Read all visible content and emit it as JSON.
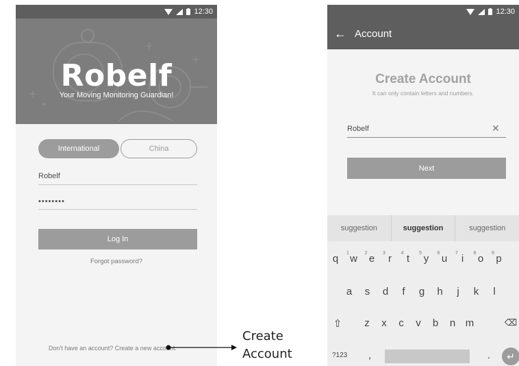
{
  "status_bar": {
    "time": "12:30",
    "icons": [
      "wifi-icon",
      "signal-icon",
      "battery-icon"
    ]
  },
  "login_screen": {
    "logo_text": "Robelf",
    "tagline": "Your Moving Monitoring Guardian!",
    "region_tabs": {
      "international": "International",
      "china": "China",
      "selected": "International"
    },
    "username_value": "Robelf",
    "password_value": "••••••••",
    "login_button": "Log In",
    "forgot_password": "Forgot password?",
    "create_account_link": "Don't have an account? Create a new account."
  },
  "annotation": {
    "line1": "Create",
    "line2": "Account"
  },
  "account_screen": {
    "app_bar_title": "Account",
    "heading": "Create Account",
    "subheading": "It can only contain letters and numbers.",
    "name_input_value": "Robelf",
    "next_button": "Next"
  },
  "keyboard": {
    "suggestions": [
      "suggestion",
      "suggestion",
      "suggestion"
    ],
    "row1": [
      "q",
      "w",
      "e",
      "r",
      "t",
      "y",
      "u",
      "i",
      "o",
      "p"
    ],
    "row1_numbers": [
      "1",
      "2",
      "3",
      "4",
      "5",
      "6",
      "7",
      "8",
      "9"
    ],
    "row2": [
      "a",
      "s",
      "d",
      "f",
      "g",
      "h",
      "j",
      "k",
      "l"
    ],
    "row3": [
      "z",
      "x",
      "c",
      "v",
      "b",
      "n",
      "m"
    ],
    "symbols_key": "?123",
    "comma_key": ",",
    "period_key": "."
  },
  "colors": {
    "dark_bar": "#5e5e5e",
    "hero_bg": "#7d7d7d",
    "button": "#9c9c9c",
    "screen_bg": "#f4f4f4"
  }
}
